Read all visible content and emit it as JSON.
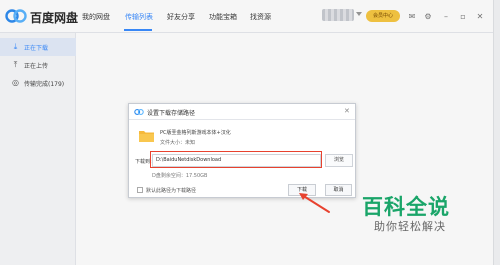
{
  "app": {
    "name": "百度网盘",
    "tabs": [
      {
        "label": "我的网盘"
      },
      {
        "label": "传输列表",
        "active": true
      },
      {
        "label": "好友分享"
      },
      {
        "label": "功能宝箱"
      },
      {
        "label": "找资源"
      }
    ],
    "vip_label": "会员中心",
    "accent_color": "#3b8cff"
  },
  "sidebar": {
    "items": [
      {
        "label": "正在下载",
        "icon": "download-icon",
        "active": true
      },
      {
        "label": "正在上传",
        "icon": "upload-icon"
      },
      {
        "label": "传输完成(179)",
        "icon": "check-circle-icon"
      }
    ]
  },
  "dialog": {
    "title": "设置下载存储路径",
    "file_name": "PC版圣金格列斯游戏本体+汉化",
    "file_size": "文件大小：未知",
    "download_to_label": "下载到:",
    "path": "D:\\BaiduNetdiskDownload",
    "browse_label": "浏览",
    "space_info": "D盘剩余空间：17.50GB",
    "default_checkbox_label": "默认此路径为下载路径",
    "download_button": "下载",
    "cancel_button": "取消",
    "highlight_color": "#e8422f"
  },
  "watermark": {
    "title": "百科全说",
    "subtitle": "助你轻松解决",
    "color": "#1aa569"
  }
}
